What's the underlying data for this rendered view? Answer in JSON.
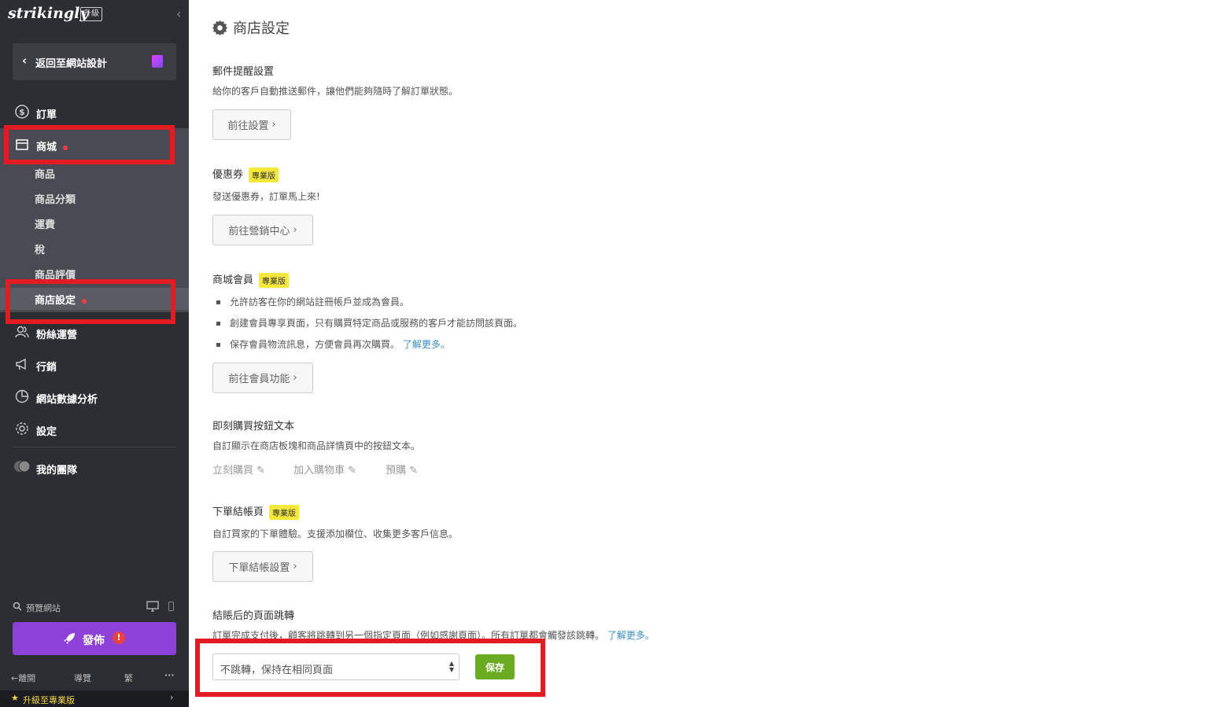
{
  "sidebar": {
    "logo": "strikingly",
    "upgrade_badge": "升級",
    "back_label": "返回至網站設計",
    "nav": {
      "orders": "訂單",
      "store": "商城",
      "fans": "粉絲運營",
      "marketing": "行銷",
      "analytics": "網站數據分析",
      "settings": "設定",
      "team": "我的團隊"
    },
    "store_sub": [
      "商品",
      "商品分類",
      "運費",
      "稅",
      "商品評價",
      "商店設定"
    ],
    "preview_label": "預覽網站",
    "publish_label": "發佈",
    "footer": {
      "exit": "離開",
      "guide": "導覽",
      "lang": "繁",
      "more": "···"
    },
    "upgrade_label": "升級至專業版"
  },
  "main": {
    "title": "商店設定",
    "sections": {
      "email": {
        "title": "郵件提醒設置",
        "desc": "給你的客戶自動推送郵件，讓他們能夠隨時了解訂單狀態。",
        "button": "前往設置"
      },
      "coupon": {
        "title": "優惠券",
        "badge": "專業版",
        "desc": "發送優惠券，訂單馬上來!",
        "button": "前往營銷中心"
      },
      "membership": {
        "title": "商城會員",
        "badge": "專業版",
        "bullets": [
          "允許訪客在你的網站註冊帳戶並成為會員。",
          "創建會員專享頁面，只有購買特定商品或服務的客戶才能訪問該頁面。",
          "保存會員物流訊息，方便會員再次購買。"
        ],
        "learn_more": "了解更多。",
        "button": "前往會員功能"
      },
      "buy_button": {
        "title": "即刻購買按鈕文本",
        "desc": "自訂顯示在商店板塊和商品詳情頁中的按鈕文本。",
        "options": [
          "立刻購買",
          "加入購物車",
          "預購"
        ]
      },
      "checkout": {
        "title": "下單結帳頁",
        "badge": "專業版",
        "desc": "自訂買家的下單體驗。支援添加欄位、收集更多客戶信息。",
        "button": "下單結帳設置"
      },
      "redirect": {
        "title": "結賬后的頁面跳轉",
        "desc": "訂單完成支付後，顧客將跳轉到另一個指定頁面（例如感謝頁面）。所有訂單都會觸發該跳轉。",
        "learn_more": "了解更多。",
        "select_value": "不跳轉，保持在相同頁面",
        "save": "保存"
      }
    }
  },
  "colors": {
    "sidebar_bg": "#2d2e33",
    "publish": "#8d41d9",
    "save": "#6aab21",
    "pro_badge": "#f4e83b",
    "highlight": "#e31b23",
    "link": "#3b8ec6"
  }
}
